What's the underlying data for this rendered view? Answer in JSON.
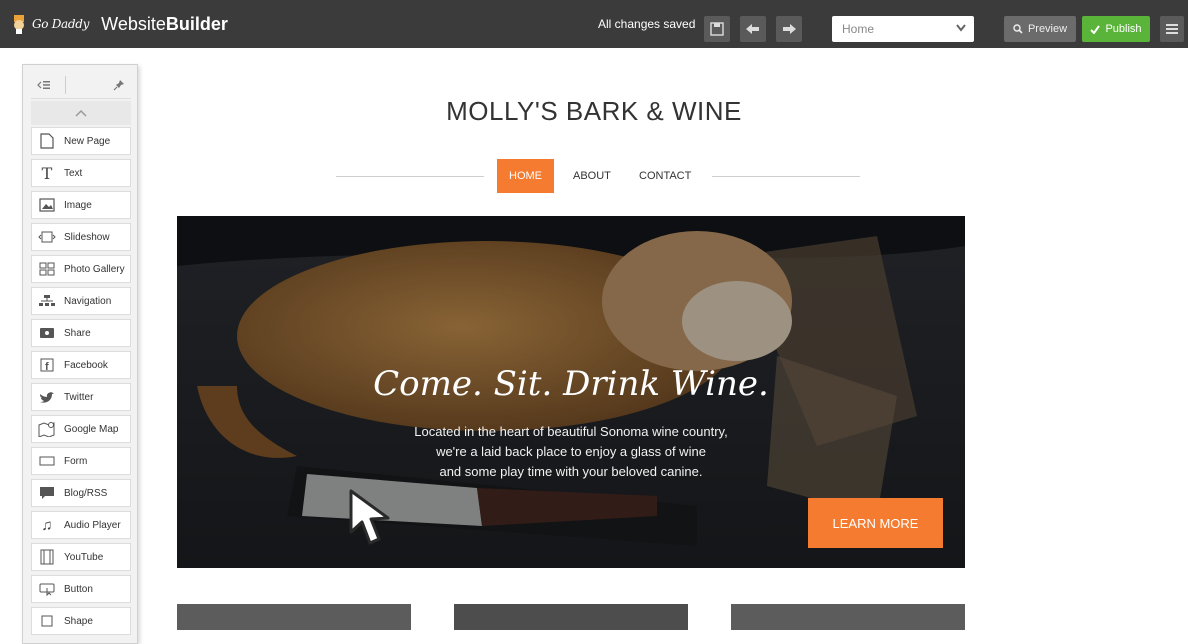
{
  "topbar": {
    "brand_godaddy": "Go Daddy",
    "brand_product_light": "Website",
    "brand_product_bold": "Builder",
    "save_status": "All changes saved",
    "page_select_value": "Home",
    "preview_label": "Preview",
    "publish_label": "Publish"
  },
  "sidebar": {
    "items": [
      {
        "label": "New Page",
        "icon": "new-page-icon"
      },
      {
        "label": "Text",
        "icon": "text-icon"
      },
      {
        "label": "Image",
        "icon": "image-icon"
      },
      {
        "label": "Slideshow",
        "icon": "slideshow-icon"
      },
      {
        "label": "Photo Gallery",
        "icon": "photo-gallery-icon"
      },
      {
        "label": "Navigation",
        "icon": "navigation-icon"
      },
      {
        "label": "Share",
        "icon": "share-icon"
      },
      {
        "label": "Facebook",
        "icon": "facebook-icon"
      },
      {
        "label": "Twitter",
        "icon": "twitter-icon"
      },
      {
        "label": "Google Map",
        "icon": "map-icon"
      },
      {
        "label": "Form",
        "icon": "form-icon"
      },
      {
        "label": "Blog/RSS",
        "icon": "blog-icon"
      },
      {
        "label": "Audio Player",
        "icon": "audio-icon"
      },
      {
        "label": "YouTube",
        "icon": "youtube-icon"
      },
      {
        "label": "Button",
        "icon": "button-icon"
      },
      {
        "label": "Shape",
        "icon": "shape-icon"
      }
    ]
  },
  "site": {
    "title": "MOLLY'S BARK & WINE",
    "nav": {
      "home": "HOME",
      "about": "ABOUT",
      "contact": "CONTACT"
    },
    "hero": {
      "tagline": "Come. Sit. Drink Wine.",
      "line1": "Located in the heart of beautiful Sonoma wine country,",
      "line2": "we're a laid back place to enjoy a glass of wine",
      "line3": "and some play time with your  beloved canine.",
      "cta": "LEARN MORE"
    }
  },
  "colors": {
    "accent": "#f47b2f",
    "publish": "#5bb43a",
    "topbar": "#3b3b3b"
  }
}
